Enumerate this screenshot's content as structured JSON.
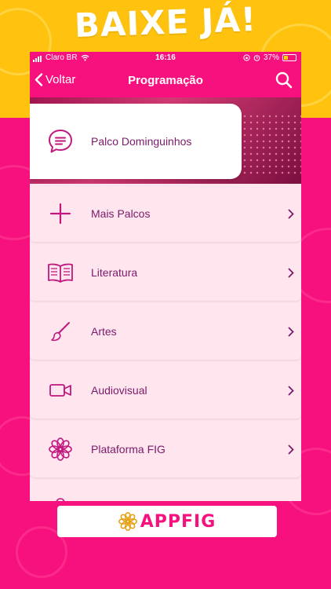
{
  "promo": {
    "headline": "BAIXE JÁ!"
  },
  "status_bar": {
    "carrier": "Claro BR",
    "time": "16:16",
    "battery": "37%"
  },
  "nav": {
    "back_label": "Voltar",
    "title": "Programação"
  },
  "featured": {
    "label": "Palco Dominguinhos",
    "icon": "chat-bubble-icon"
  },
  "menu": {
    "items": [
      {
        "label": "Mais Palcos",
        "icon": "plus-icon"
      },
      {
        "label": "Literatura",
        "icon": "book-icon"
      },
      {
        "label": "Artes",
        "icon": "paintbrush-icon"
      },
      {
        "label": "Audiovisual",
        "icon": "video-camera-icon"
      },
      {
        "label": "Plataforma FIG",
        "icon": "flower-icon"
      }
    ]
  },
  "footer_badge": {
    "brand": "APPFIG"
  },
  "colors": {
    "brand_pink": "#f7117e",
    "accent_yellow": "#ffc20e",
    "text_purple": "#7a1a6a",
    "icon_magenta": "#c0177d"
  }
}
